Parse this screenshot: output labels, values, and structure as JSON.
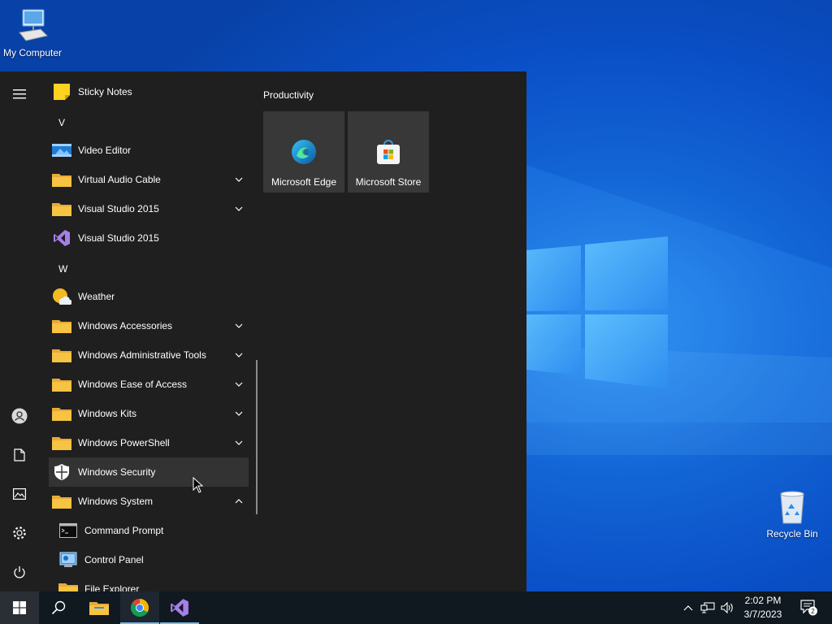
{
  "desktop": {
    "icons": [
      {
        "label": "My Computer",
        "icon": "computer-icon"
      },
      {
        "label": "Recycle Bin",
        "icon": "recycle-bin-icon"
      }
    ]
  },
  "start_menu": {
    "rail": {
      "top": [
        {
          "icon": "hamburger-menu-icon"
        }
      ],
      "bottom": [
        {
          "icon": "user-account-icon"
        },
        {
          "icon": "documents-icon"
        },
        {
          "icon": "pictures-icon"
        },
        {
          "icon": "settings-gear-icon"
        },
        {
          "icon": "power-icon"
        }
      ]
    },
    "apps": [
      {
        "type": "app",
        "label": "Sticky Notes",
        "icon": "sticky-notes-icon"
      },
      {
        "type": "letter",
        "label": "V"
      },
      {
        "type": "app",
        "label": "Video Editor",
        "icon": "video-editor-icon"
      },
      {
        "type": "folder",
        "label": "Virtual Audio Cable",
        "expanded": false
      },
      {
        "type": "folder",
        "label": "Visual Studio 2015",
        "expanded": false
      },
      {
        "type": "app",
        "label": "Visual Studio 2015",
        "icon": "visual-studio-icon"
      },
      {
        "type": "letter",
        "label": "W"
      },
      {
        "type": "app",
        "label": "Weather",
        "icon": "weather-icon"
      },
      {
        "type": "folder",
        "label": "Windows Accessories",
        "expanded": false
      },
      {
        "type": "folder",
        "label": "Windows Administrative Tools",
        "expanded": false
      },
      {
        "type": "folder",
        "label": "Windows Ease of Access",
        "expanded": false
      },
      {
        "type": "folder",
        "label": "Windows Kits",
        "expanded": false
      },
      {
        "type": "folder",
        "label": "Windows PowerShell",
        "expanded": false
      },
      {
        "type": "app",
        "label": "Windows Security",
        "icon": "shield-icon",
        "hover": true
      },
      {
        "type": "folder",
        "label": "Windows System",
        "expanded": true
      },
      {
        "type": "subapp",
        "label": "Command Prompt",
        "icon": "command-prompt-icon"
      },
      {
        "type": "subapp",
        "label": "Control Panel",
        "icon": "control-panel-icon"
      },
      {
        "type": "subapp",
        "label": "File Explorer",
        "icon": "file-explorer-icon"
      }
    ],
    "tiles_group": "Productivity",
    "tiles": [
      {
        "label": "Microsoft Edge",
        "icon": "edge-icon"
      },
      {
        "label": "Microsoft Store",
        "icon": "store-icon"
      }
    ]
  },
  "taskbar": {
    "buttons": [
      {
        "name": "start-button",
        "icon": "windows-logo-icon"
      },
      {
        "name": "search-button",
        "icon": "search-icon"
      },
      {
        "name": "file-explorer-button",
        "icon": "folder-icon"
      },
      {
        "name": "chrome-button",
        "icon": "chrome-icon"
      },
      {
        "name": "visual-studio-button",
        "icon": "visual-studio-icon"
      }
    ],
    "tray": {
      "time": "2:02 PM",
      "date": "3/7/2023",
      "notification_count": "2"
    }
  },
  "colors": {
    "menu_bg": "#1f1f1f",
    "tile_bg": "#383838",
    "hover_bg": "#333333",
    "taskbar_bg": "#101820",
    "folder_yellow": "#f6c342",
    "vs_purple": "#8661c5"
  }
}
